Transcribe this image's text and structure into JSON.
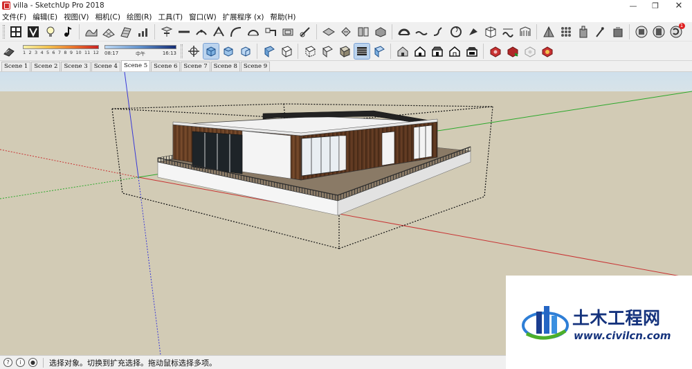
{
  "window": {
    "title": "villa - SketchUp Pro 2018",
    "controls": {
      "minimize": "—",
      "maximize": "❐",
      "close": "✕"
    }
  },
  "menubar": {
    "items": [
      "文件(F)",
      "编辑(E)",
      "视图(V)",
      "相机(C)",
      "绘图(R)",
      "工具(T)",
      "窗口(W)",
      "扩展程序 (x)",
      "帮助(H)"
    ]
  },
  "toolbar1": {
    "icons": [
      "style-builder-icon",
      "environment-icon",
      "light-bulb-icon",
      "music-note-icon",
      "sandbox-from-contours-icon",
      "sandbox-from-scratch-icon",
      "smoove-icon",
      "stamp-icon",
      "drape-icon",
      "add-detail-icon",
      "flip-edge-icon",
      "weld-icon",
      "curve-icon",
      "arc-icon",
      "follow-me-icon",
      "offset-icon",
      "push-pull-icon",
      "scale-icon",
      "rotate-icon",
      "intersect-icon",
      "solid-union-icon",
      "solid-subtract-icon",
      "solid-trim-icon",
      "solid-split-icon",
      "shell-icon",
      "outer-shell-icon",
      "tape-measure-icon",
      "protractor-icon",
      "dimension-icon",
      "text-icon",
      "axes-icon",
      "section-plane-icon",
      "3d-text-icon",
      "warehouse-icon",
      "extension-icon",
      "notifications-icon"
    ],
    "notification_badge": "1"
  },
  "toolbar2": {
    "shadow_settings": {
      "month_labels": [
        "1",
        "2",
        "3",
        "4",
        "5",
        "6",
        "7",
        "8",
        "9",
        "10",
        "11",
        "12"
      ],
      "time_start": "08:17",
      "time_mid": "中午",
      "time_end": "16:13"
    },
    "icons": [
      "orbit-icon",
      "iso-view-icon",
      "top-view-icon",
      "front-view-icon",
      "xray-icon",
      "wireframe-icon",
      "hidden-line-icon",
      "shaded-icon",
      "shaded-textures-icon",
      "monochrome-icon",
      "house-style-1-icon",
      "house-style-2-icon",
      "house-style-3-icon",
      "house-style-4-icon",
      "house-style-5-icon",
      "component-icon",
      "component-add-icon",
      "component-outline-icon",
      "component-options-icon"
    ],
    "active_icons": [
      "iso-view-icon",
      "shaded-textures-icon"
    ]
  },
  "scene_tabs": {
    "items": [
      "Scene 1",
      "Scene 2",
      "Scene 3",
      "Scene 4",
      "Scene 5",
      "Scene 6",
      "Scene 7",
      "Scene 8",
      "Scene 9"
    ],
    "active": "Scene 5"
  },
  "viewport": {
    "ground_color": "#d2cbb5",
    "sky_color": "#d2e0ea",
    "axis_colors": {
      "red": "#c83232",
      "green": "#2aa82a",
      "blue": "#3838d8"
    }
  },
  "statusbar": {
    "icons": [
      "geo-location-icon",
      "credits-icon",
      "user-icon"
    ],
    "text": "选择对象。切换到扩充选择。拖动鼠标选择多项。"
  },
  "watermark": {
    "title": "土木工程网",
    "url": "www.civilcn.com"
  }
}
